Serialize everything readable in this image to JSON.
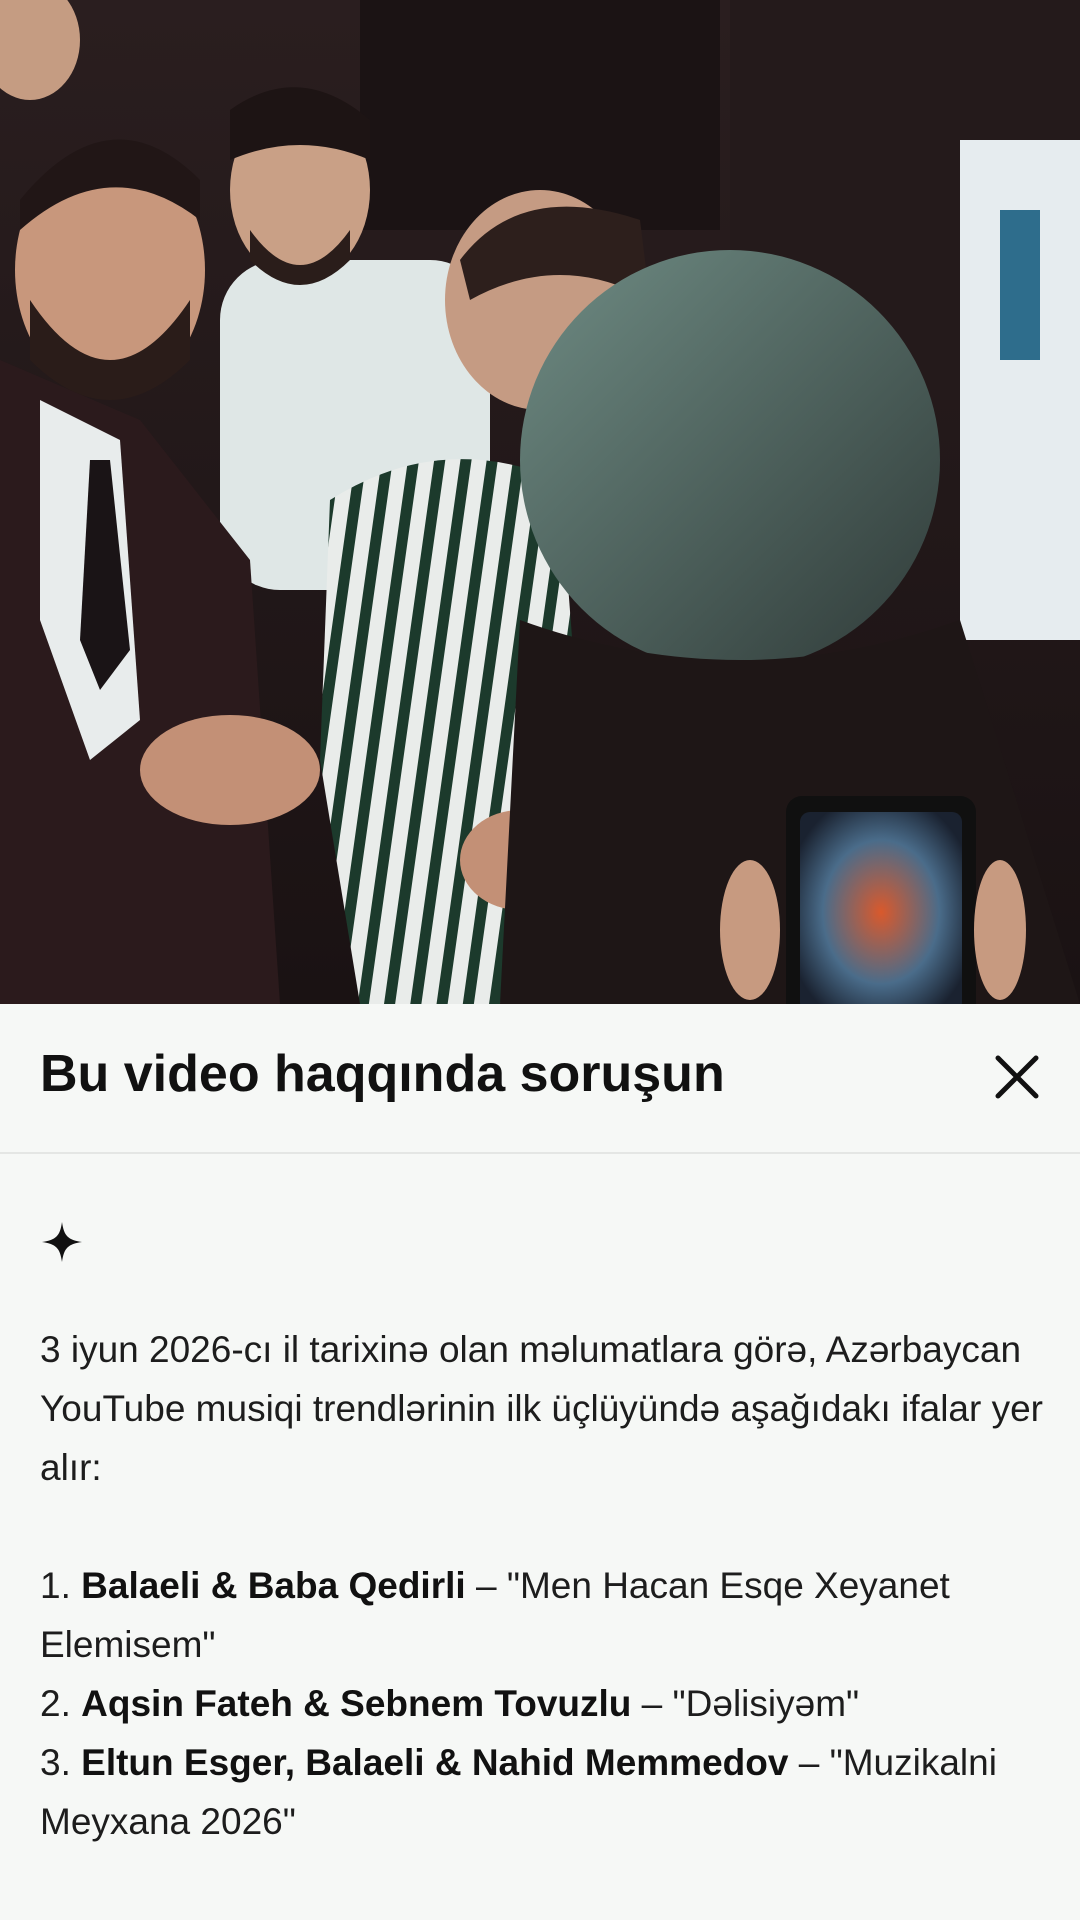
{
  "video": {
    "description_icon": "video-frame"
  },
  "sheet": {
    "title": "Bu video haqqında soruşun",
    "close_icon": "close-icon",
    "sparkle_icon": "sparkle-icon",
    "intro": "3 iyun 2026-cı il tarixinə olan məlumatlara görə, Azərbaycan YouTube musiqi trendlərinin ilk üçlüyündə aşağıdakı ifalar yer alır:",
    "items": [
      {
        "number": "1.",
        "artist": "Balaeli & Baba Qedirli",
        "separator": " – ",
        "song": "\"Men Hacan Esqe Xeyanet Elemisem\""
      },
      {
        "number": "2.",
        "artist": "Aqsin Fateh & Sebnem Tovuzlu",
        "separator": " – ",
        "song": "\"Dəlisiyəm\""
      },
      {
        "number": "3.",
        "artist": "Eltun Esger, Balaeli & Nahid Memmedov",
        "separator": " – ",
        "song": "\"Muzikalni Meyxana 2026\""
      }
    ]
  },
  "colors": {
    "sheet_bg": "#f6f8f6",
    "title": "#111111",
    "text": "#1d1d1d",
    "divider": "#e4e6e4"
  }
}
